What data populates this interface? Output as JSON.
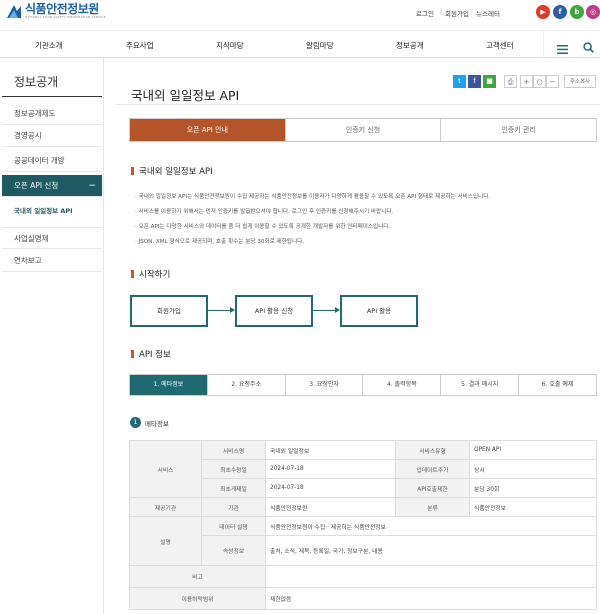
{
  "header": {
    "logo_text": "식품안전정보원",
    "logo_sub": "NATIONAL FOOD SAFETY INFORMATION SERVICE",
    "util_links": [
      "로그인",
      "회원가입",
      "뉴스레터"
    ],
    "sns": [
      {
        "name": "youtube-icon",
        "glyph": "▶",
        "color": "#e03a2a"
      },
      {
        "name": "facebook-icon",
        "glyph": "f",
        "color": "#2d5fa8"
      },
      {
        "name": "blog-icon",
        "glyph": "b",
        "color": "#3aa83c"
      },
      {
        "name": "instagram-icon",
        "glyph": "◎",
        "color": "#c0398a"
      }
    ]
  },
  "gnb": [
    "기관소개",
    "주요사업",
    "지식마당",
    "알림마당",
    "정보공개",
    "고객센터"
  ],
  "sidebar": {
    "title": "정보공개",
    "items": [
      "정보공개제도",
      "경영공시",
      "공공데이터 개방",
      "오픈 API 신청",
      "사업실명제",
      "연차보고"
    ],
    "active_toggle": "−",
    "sub_item": "국내외 일일정보 API"
  },
  "page": {
    "title": "국내외 일일정보 API",
    "toolbar": {
      "twitter": "t",
      "facebook": "f",
      "kakao": "■",
      "print": "⎙",
      "zoom_in": "+",
      "reset": "○",
      "zoom_out": "−",
      "url_copy": "주소복사"
    }
  },
  "tabs": [
    "오픈 API 안내",
    "인증키 신청",
    "인증키 관리"
  ],
  "sections": {
    "intro_title": "국내외 일일정보 API",
    "intro_lines": [
      "국내외 일일정보 API는 식품안전정보원이 수집 제공하는 식품안전정보를 이용자가 다양하게 활용할 수 있도록 오픈 API 형태로 제공하는 서비스입니다.",
      "서비스를 이용하기 위해서는 먼저 인증키를 발급받으셔야 합니다. 로그인 후 인증키를 신청해주시기 바랍니다.",
      "오픈 API는 다양한 서비스와 데이터를 좀 더 쉽게 이용할 수 있도록 공개한 개발자를 위한 인터페이스입니다.",
      "JSON, XML 형식으로 제공되며, 호출 횟수는 분당 30회로 제한됩니다."
    ],
    "start_title": "시작하기",
    "flow": [
      "회원가입",
      "API 활용 신청",
      "API 활용"
    ],
    "api_title": "API 정보",
    "api_tabs": [
      "1. 메타정보",
      "2. 요청주소",
      "3. 요청인자",
      "4. 출력항목",
      "5. 결과 메시지",
      "6. 호출 예제"
    ],
    "meta_num": "1",
    "meta_title": "메타정보"
  },
  "meta_table": {
    "service": "서비스",
    "service_name_label": "서비스명",
    "service_name": "국내외 일일정보",
    "service_type_label": "서비스유형",
    "service_type": "OPEN API",
    "first_reg_label": "최초수정일",
    "first_reg": "2024-07-18",
    "update_cycle_label": "업데이트주기",
    "update_cycle": "상시",
    "last_reg_label": "최초게재일",
    "last_reg": "2024-07-18",
    "api_limit_label": "API호출제한",
    "api_limit": "분당 30회",
    "org_group": "제공기관",
    "org_label": "기관",
    "org": "식품안전정보원",
    "category_label": "분류",
    "category": "식품안전정보",
    "desc_group": "설명",
    "data_desc_label": "데이터 설명",
    "data_desc": "식품안전정보원이 수집 · 제공하는 식품안전정보",
    "attr_label": "속성정보",
    "attr": "출처, 소식, 제목, 등록일, 국가, 정보구분, 내용",
    "note_label": "비고",
    "note": "",
    "license_label": "이용허락범위",
    "license": "제한없음"
  }
}
